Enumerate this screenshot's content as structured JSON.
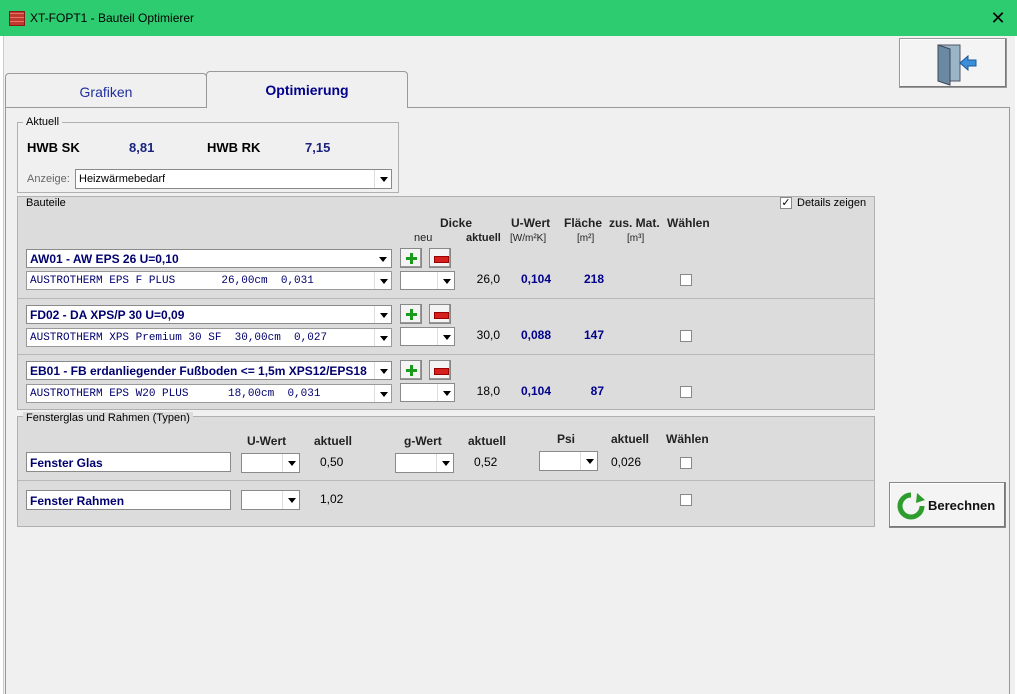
{
  "window": {
    "title": "XT-FOPT1 - Bauteil Optimierer",
    "close": "✕"
  },
  "tabs": [
    {
      "label": "Grafiken"
    },
    {
      "label": "Optimierung"
    }
  ],
  "aktuell": {
    "group_label": "Aktuell",
    "hwb_sk_label": "HWB SK",
    "hwb_sk_value": "8,81",
    "hwb_rk_label": "HWB RK",
    "hwb_rk_value": "7,15",
    "anzeige_label": "Anzeige:",
    "anzeige_value": "Heizwärmebedarf"
  },
  "bauteile": {
    "group_label": "Bauteile",
    "details_label": "Details zeigen",
    "details_checked": true,
    "headers": {
      "neu": "neu",
      "dicke": "Dicke",
      "aktuell": "aktuell",
      "uwert": "U-Wert",
      "uwert_unit": "[W/m²K]",
      "flaeche": "Fläche",
      "flaeche_unit": "[m²]",
      "zusmat": "zus. Mat.",
      "zusmat_unit": "[m³]",
      "waehlen": "Wählen"
    },
    "rows": [
      {
        "name": "AW01 - AW EPS 26 U=0,10",
        "material": "AUSTROTHERM EPS F PLUS       26,00cm  0,031",
        "dicke": "26,0",
        "uwert": "0,104",
        "flaeche": "218"
      },
      {
        "name": "FD02 - DA XPS/P 30 U=0,09",
        "material": "AUSTROTHERM XPS Premium 30 SF  30,00cm  0,027",
        "dicke": "30,0",
        "uwert": "0,088",
        "flaeche": "147"
      },
      {
        "name": "EB01 - FB  erdanliegender Fußboden <= 1,5m XPS12/EPS18",
        "material": "AUSTROTHERM EPS W20 PLUS      18,00cm  0,031",
        "dicke": "18,0",
        "uwert": "0,104",
        "flaeche": "87"
      }
    ]
  },
  "fenster": {
    "group_label": "Fensterglas und Rahmen  (Typen)",
    "headers": {
      "uwert": "U-Wert",
      "aktuell1": "aktuell",
      "gwert": "g-Wert",
      "aktuell2": "aktuell",
      "psi": "Psi",
      "aktuell3": "aktuell",
      "waehlen": "Wählen"
    },
    "glas": {
      "name": "Fenster Glas",
      "u_aktuell": "0,50",
      "g_aktuell": "0,52",
      "psi_aktuell": "0,026"
    },
    "rahmen": {
      "name": "Fenster Rahmen",
      "u_aktuell": "1,02"
    }
  },
  "actions": {
    "berechnen": "Berechnen"
  }
}
